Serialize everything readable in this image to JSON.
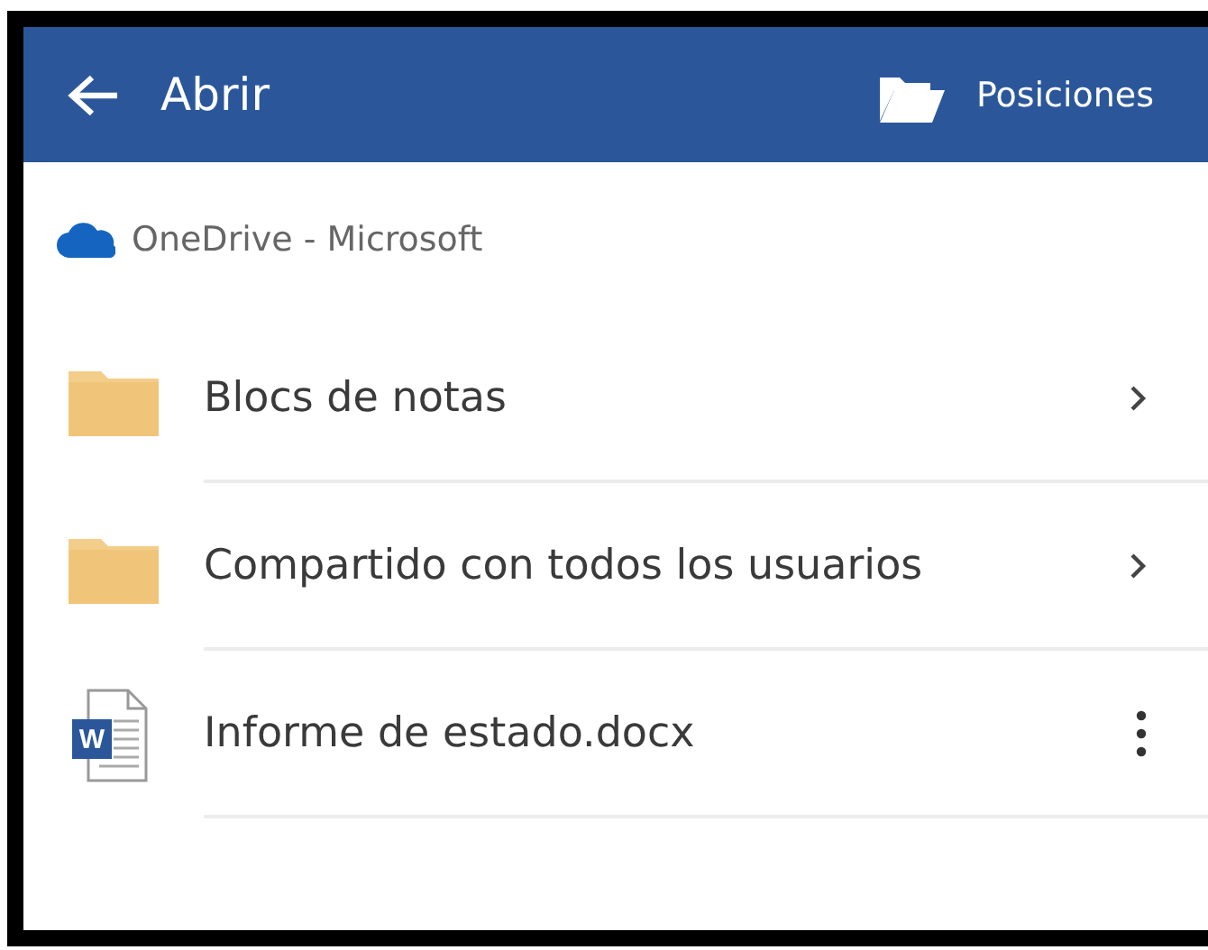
{
  "header": {
    "title": "Abrir",
    "action": "Posiciones"
  },
  "location": {
    "label": "OneDrive - Microsoft"
  },
  "items": [
    {
      "kind": "folder",
      "name": "Blocs de notas"
    },
    {
      "kind": "folder",
      "name": "Compartido con todos los usuarios"
    },
    {
      "kind": "document",
      "name": "Informe de estado.docx",
      "icon_letter": "W"
    }
  ]
}
